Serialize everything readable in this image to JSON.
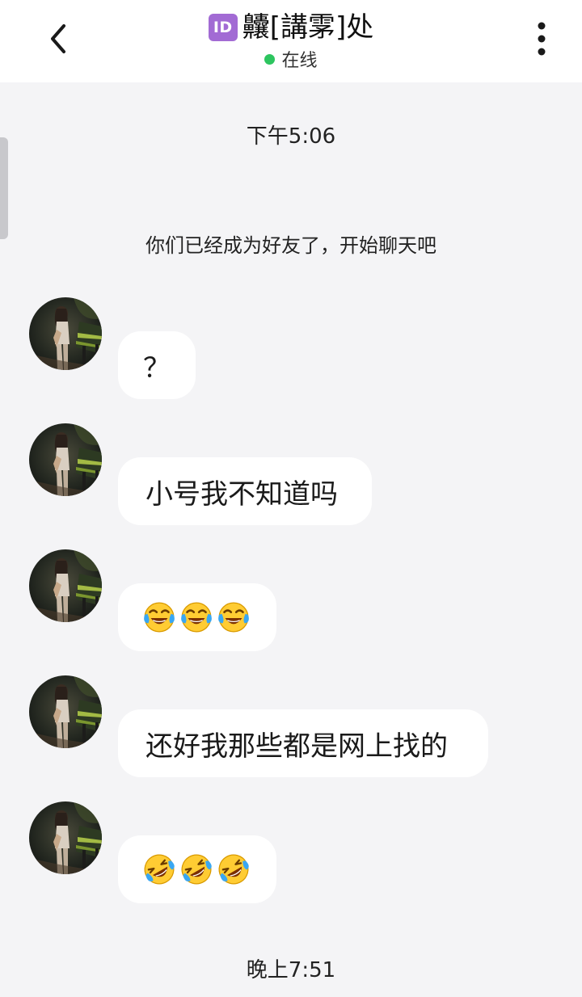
{
  "header": {
    "badge_text": "ID",
    "title": "齉[講雺]处",
    "status": "在线",
    "status_color": "#2dc55f",
    "back_icon": "chevron-left-icon",
    "menu_icon": "more-vertical-icon"
  },
  "chat": {
    "timestamp_1": "下午5:06",
    "system_message": "你们已经成为好友了，开始聊天吧",
    "messages": [
      {
        "type": "text",
        "text": "？"
      },
      {
        "type": "text",
        "text": "小号我不知道吗"
      },
      {
        "type": "emoji",
        "emoji_name": "face-with-tears-of-joy",
        "count": 3
      },
      {
        "type": "text",
        "text": "还好我那些都是网上找的"
      },
      {
        "type": "emoji",
        "emoji_name": "rolling-on-the-floor-laughing",
        "count": 3
      }
    ],
    "timestamp_2": "晚上7:51"
  },
  "colors": {
    "background": "#f4f4f6",
    "bubble": "#ffffff",
    "badge": "#a26bd4"
  }
}
